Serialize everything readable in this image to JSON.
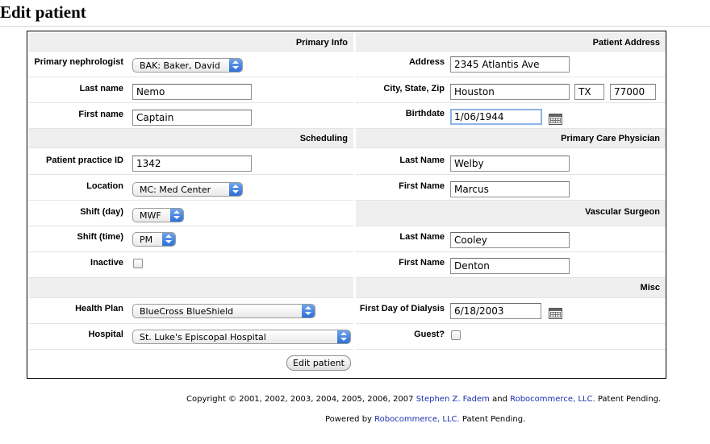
{
  "page": {
    "title": "Edit patient"
  },
  "sections": {
    "primary_info": "Primary Info",
    "patient_address": "Patient Address",
    "scheduling": "Scheduling",
    "primary_care_physician": "Primary Care Physician",
    "vascular_surgeon": "Vascular Surgeon",
    "misc": "Misc"
  },
  "primary_info": {
    "nephrologist_label": "Primary nephrologist",
    "nephrologist_value": "BAK: Baker, David",
    "last_name_label": "Last name",
    "last_name_value": "Nemo",
    "first_name_label": "First name",
    "first_name_value": "Captain"
  },
  "address": {
    "address_label": "Address",
    "address_value": "2345 Atlantis Ave",
    "csz_label": "City, State, Zip",
    "city_value": "Houston",
    "state_value": "TX",
    "zip_value": "77000",
    "birthdate_label": "Birthdate",
    "birthdate_value": "1/06/1944"
  },
  "scheduling": {
    "practice_id_label": "Patient practice ID",
    "practice_id_value": "1342",
    "location_label": "Location",
    "location_value": "MC: Med Center",
    "shift_day_label": "Shift (day)",
    "shift_day_value": "MWF",
    "shift_time_label": "Shift (time)",
    "shift_time_value": "PM",
    "inactive_label": "Inactive",
    "inactive_checked": false
  },
  "pcp": {
    "last_name_label": "Last Name",
    "last_name_value": "Welby",
    "first_name_label": "First Name",
    "first_name_value": "Marcus"
  },
  "surgeon": {
    "last_name_label": "Last Name",
    "last_name_value": "Cooley",
    "first_name_label": "First Name",
    "first_name_value": "Denton"
  },
  "misc": {
    "health_plan_label": "Health Plan",
    "health_plan_value": "BlueCross BlueShield",
    "hospital_label": "Hospital",
    "hospital_value": "St. Luke's Episcopal Hospital",
    "dialysis_label": "First Day of Dialysis",
    "dialysis_value": "6/18/2003",
    "guest_label": "Guest?",
    "guest_checked": false
  },
  "actions": {
    "submit_label": "Edit patient"
  },
  "footer": {
    "copyright_prefix": "Copyright © 2001, 2002, 2003, 2004, 2005, 2006, 2007",
    "author_link": "Stephen Z. Fadem",
    "and_text": "and",
    "company_link": "Robocommerce, LLC.",
    "patent_text": "Patent Pending.",
    "powered_prefix": "Powered by",
    "powered_link": "Robocommerce, LLC.",
    "powered_suffix": "Patent Pending."
  },
  "icons": {
    "calendar": "calendar-icon",
    "select_arrows": "select-arrows-icon"
  },
  "colors": {
    "link": "#1a2fb0",
    "section_bg": "#efefef",
    "select_accent": "#2f6fd6"
  }
}
